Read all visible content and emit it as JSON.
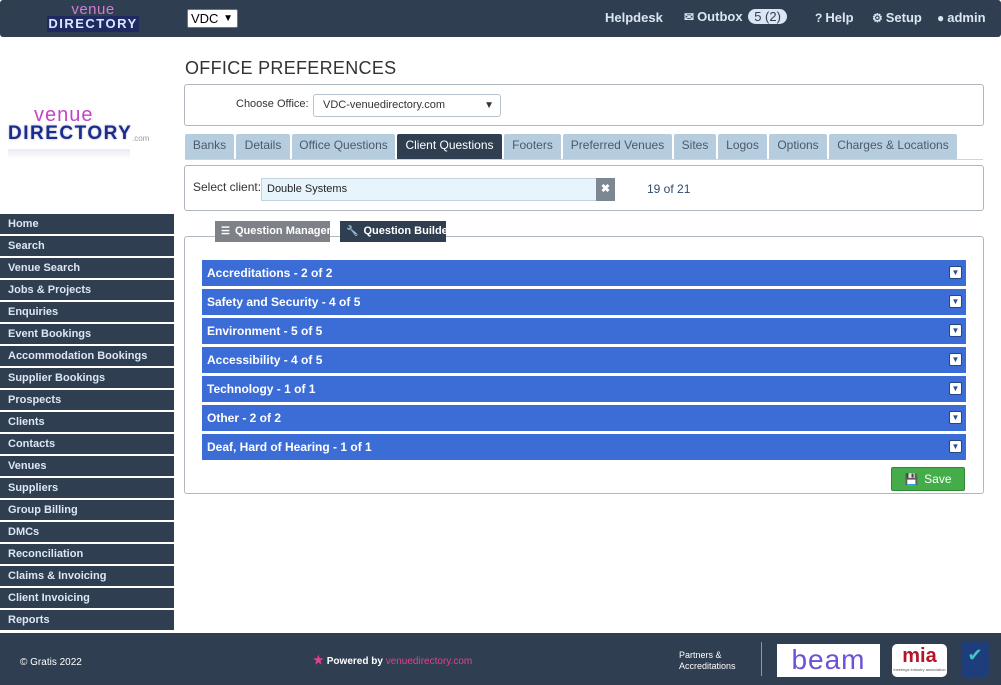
{
  "topbar": {
    "logo_line1": "venue",
    "logo_line2": "DIRECTORY",
    "office_select": "VDC",
    "helpdesk": "Helpdesk",
    "outbox": "Outbox",
    "outbox_count": "5 (2)",
    "help": "Help",
    "setup": "Setup",
    "user": "admin"
  },
  "side_logo": {
    "line1": "venue",
    "line2": "DIRECTORY",
    "com": ".com"
  },
  "sidebar": {
    "items": [
      {
        "label": "Home"
      },
      {
        "label": "Search"
      },
      {
        "label": "Venue Search"
      },
      {
        "label": "Jobs & Projects"
      },
      {
        "label": "Enquiries"
      },
      {
        "label": "Event Bookings"
      },
      {
        "label": "Accommodation Bookings"
      },
      {
        "label": "Supplier Bookings"
      },
      {
        "label": "Prospects"
      },
      {
        "label": "Clients"
      },
      {
        "label": "Contacts"
      },
      {
        "label": "Venues"
      },
      {
        "label": "Suppliers"
      },
      {
        "label": "Group Billing"
      },
      {
        "label": "DMCs"
      },
      {
        "label": "Reconciliation"
      },
      {
        "label": "Claims & Invoicing"
      },
      {
        "label": "Client Invoicing"
      },
      {
        "label": "Reports"
      }
    ]
  },
  "main": {
    "title": "OFFICE PREFERENCES",
    "choose_office_label": "Choose Office:",
    "choose_office_value": "VDC-venuedirectory.com",
    "tabs": [
      {
        "label": "Banks"
      },
      {
        "label": "Details"
      },
      {
        "label": "Office Questions"
      },
      {
        "label": "Client Questions",
        "active": true
      },
      {
        "label": "Footers"
      },
      {
        "label": "Preferred Venues"
      },
      {
        "label": "Sites"
      },
      {
        "label": "Logos"
      },
      {
        "label": "Options"
      },
      {
        "label": "Charges & Locations"
      }
    ],
    "select_client_label": "Select client:",
    "client_value": "Double Systems",
    "client_count": "19 of 21",
    "question_manager": "Question Manager",
    "question_builder": "Question Builder",
    "sections": [
      {
        "label": "Accreditations - 2 of 2"
      },
      {
        "label": "Safety and Security - 4 of 5"
      },
      {
        "label": "Environment - 5 of 5"
      },
      {
        "label": "Accessibility - 4 of 5"
      },
      {
        "label": "Technology - 1 of 1"
      },
      {
        "label": "Other - 2 of 2"
      },
      {
        "label": "Deaf, Hard of Hearing - 1 of 1"
      }
    ],
    "save": "Save"
  },
  "footer": {
    "copyright": "© Gratis 2022",
    "powered_by": "Powered by",
    "powered_link": "venuedirectory.com",
    "partners_line1": "Partners &",
    "partners_line2": "Accreditations",
    "beam": "beam",
    "mia": "mia",
    "mia_sub": "meetings industry association"
  },
  "colors": {
    "navbar": "#2f3e50",
    "section_header": "#3c6dd6",
    "tab_inactive": "#b6cde0",
    "save_green": "#44ad49",
    "brand_pink": "#e53f91"
  }
}
